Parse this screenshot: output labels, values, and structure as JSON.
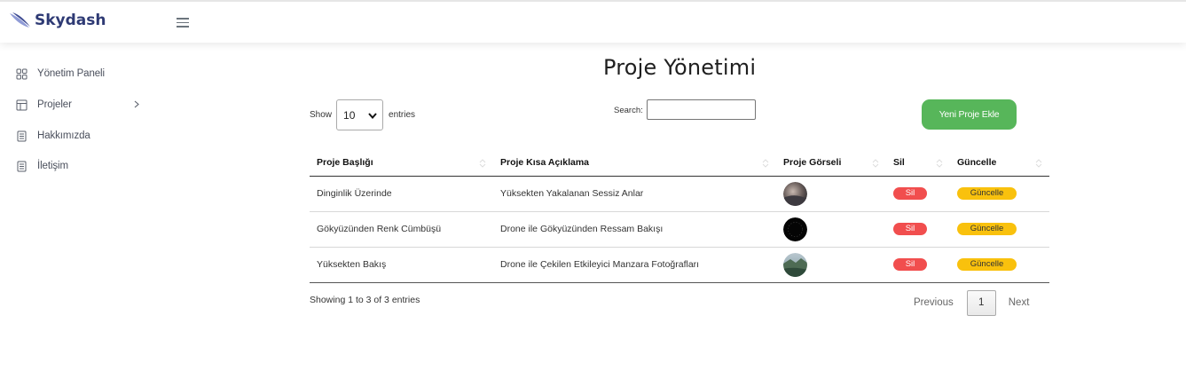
{
  "app": {
    "brand": "Skydash"
  },
  "sidebar": {
    "items": [
      {
        "label": "Yönetim Paneli",
        "icon": "grid-icon"
      },
      {
        "label": "Projeler",
        "icon": "layout-icon"
      },
      {
        "label": "Hakkımızda",
        "icon": "document-icon"
      },
      {
        "label": "İletişim",
        "icon": "document-icon"
      }
    ]
  },
  "main": {
    "title": "Proje Yönetimi",
    "show_label": "Show",
    "entries_value": "10",
    "entries_label": "entries",
    "search_label": "Search:",
    "search_value": "",
    "add_button": "Yeni Proje Ekle"
  },
  "table": {
    "headers": [
      "Proje Başlığı",
      "Proje Kısa Açıklama",
      "Proje Görseli",
      "Sil",
      "Güncelle"
    ],
    "rows": [
      {
        "title": "Dinginlik Üzerinde",
        "desc": "Yüksekten Yakalanan Sessiz Anlar",
        "delete": "Sil",
        "update": "Güncelle"
      },
      {
        "title": "Gökyüzünden Renk Cümbüşü",
        "desc": "Drone ile Gökyüzünden Ressam Bakışı",
        "delete": "Sil",
        "update": "Güncelle"
      },
      {
        "title": "Yüksekten Bakış",
        "desc": "Drone ile Çekilen Etkileyici Manzara Fotoğrafları",
        "delete": "Sil",
        "update": "Güncelle"
      }
    ]
  },
  "footer": {
    "info": "Showing 1 to 3 of 3 entries",
    "previous": "Previous",
    "page": "1",
    "next": "Next"
  },
  "colors": {
    "brand": "#2e3a74",
    "add": "#57b65a",
    "delete": "#f14e4e",
    "update": "#f9c10d"
  }
}
